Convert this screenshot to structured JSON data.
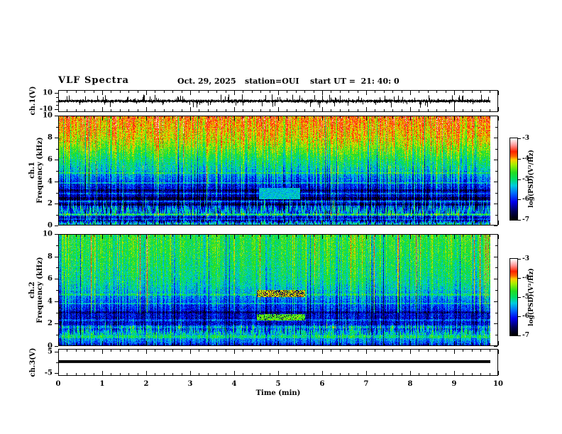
{
  "header": {
    "title": "VLF Spectra",
    "date": "Oct. 29, 2025",
    "station": "station=OUI",
    "start_ut": "start UT =  21: 40: 0"
  },
  "chart_data": {
    "type": "heatmap",
    "title": "VLF Spectra",
    "x_axis": {
      "label": "Time (min)",
      "min": 0,
      "max": 10,
      "major_step": 1,
      "minor_step": 0.2,
      "data_end": 9.84
    },
    "colormap": {
      "vmin": -7,
      "vmax": -3,
      "stops": [
        [
          0,
          "#000000"
        ],
        [
          0.1,
          "#000055"
        ],
        [
          0.22,
          "#0000ee"
        ],
        [
          0.32,
          "#0066ff"
        ],
        [
          0.42,
          "#00ccdd"
        ],
        [
          0.5,
          "#00dd66"
        ],
        [
          0.58,
          "#22dd22"
        ],
        [
          0.68,
          "#aaee00"
        ],
        [
          0.74,
          "#ffcc00"
        ],
        [
          0.78,
          "#ff6600"
        ],
        [
          0.84,
          "#ff2200"
        ],
        [
          0.92,
          "#ff9999"
        ],
        [
          1,
          "#ffffff"
        ]
      ]
    },
    "colorbars": [
      {
        "label": "log(PSD)(V²/Hz)",
        "ticks": [
          -3,
          -4,
          -5,
          -6,
          -7
        ]
      },
      {
        "label": "log(PSD)(V²/Hz)",
        "ticks": [
          -3,
          -4,
          -5,
          -6,
          -7
        ]
      }
    ],
    "panels": [
      {
        "id": "ch1_wave",
        "type": "waveform",
        "ylabel": "ch.1(V)",
        "ymin": -13,
        "ymax": 13,
        "yticks": [
          10,
          5,
          0,
          -5,
          -10
        ],
        "ytick_labels": {
          "10": "10",
          "-10": "-10"
        },
        "signal": {
          "noise_amp": 1.4,
          "spike_prob": 0.25,
          "spike_max": 8.5,
          "seed": 11
        }
      },
      {
        "id": "ch1_spec",
        "type": "spectrogram",
        "ylabel_lines": [
          "ch.1",
          "Frequency (kHz)"
        ],
        "fmin": 0,
        "fmax": 10,
        "ytick_major": [
          0,
          2,
          4,
          6,
          8,
          10
        ],
        "ytick_minor": [
          1,
          3,
          5,
          7,
          9
        ],
        "seed": 7,
        "profile": [
          [
            0,
            -5.4
          ],
          [
            0.15,
            -5.1
          ],
          [
            0.4,
            -6.5
          ],
          [
            0.8,
            -6.1
          ],
          [
            1.1,
            -5.15
          ],
          [
            1.5,
            -5.5
          ],
          [
            1.8,
            -6.25
          ],
          [
            2.6,
            -6.4
          ],
          [
            3.6,
            -6.05
          ],
          [
            4.4,
            -5.6
          ],
          [
            5,
            -5.25
          ],
          [
            6,
            -4.9
          ],
          [
            7,
            -4.45
          ],
          [
            8,
            -4.1
          ],
          [
            10,
            -3.8
          ]
        ],
        "h_lines": [
          {
            "f": 0.55,
            "dv": 0.5,
            "w": 0.08
          },
          {
            "f": 0.95,
            "dv": 0.7,
            "w": 0.1
          },
          {
            "f": 1.9,
            "dv": -0.5,
            "w": 0.12
          },
          {
            "f": 2.2,
            "dv": 0.55,
            "w": 0.07
          },
          {
            "f": 2.45,
            "dv": -0.45,
            "w": 0.1
          },
          {
            "f": 2.9,
            "dv": 0.5,
            "w": 0.07
          },
          {
            "f": 3.2,
            "dv": -0.4,
            "w": 0.1
          },
          {
            "f": 3.9,
            "dv": 0.55,
            "w": 0.07
          },
          {
            "f": 4.8,
            "dv": 0.45,
            "w": 0.07
          }
        ],
        "features": [
          {
            "t0": 4.55,
            "t1": 5.5,
            "f0": 2.4,
            "f1": 3.4,
            "v": -5.35,
            "speckle": 0
          }
        ],
        "jag": 0.5,
        "col_jitter": 0.33,
        "cell_noise": 0.3,
        "streak_prob": 0.07,
        "streak_boost": 0.85,
        "streak_band": [
          0.4,
          5.5
        ]
      },
      {
        "id": "ch2_spec",
        "type": "spectrogram",
        "ylabel_lines": [
          "ch.2",
          "Frequency (kHz)"
        ],
        "fmin": 0,
        "fmax": 10,
        "ytick_major": [
          0,
          2,
          4,
          6,
          8,
          10
        ],
        "ytick_minor": [
          1,
          3,
          5,
          7,
          9
        ],
        "seed": 13,
        "profile": [
          [
            0,
            -6.3
          ],
          [
            0.2,
            -5.8
          ],
          [
            0.5,
            -5.55
          ],
          [
            0.9,
            -5.35
          ],
          [
            1.2,
            -4.95
          ],
          [
            1.5,
            -5.9
          ],
          [
            2.1,
            -6.3
          ],
          [
            2.7,
            -6.2
          ],
          [
            3.4,
            -6.0
          ],
          [
            4.2,
            -5.65
          ],
          [
            5,
            -5.3
          ],
          [
            6,
            -5.05
          ],
          [
            7,
            -4.95
          ],
          [
            8.5,
            -4.8
          ],
          [
            10,
            -4.75
          ]
        ],
        "h_lines": [
          {
            "f": 0.8,
            "dv": 0.4,
            "w": 0.1
          },
          {
            "f": 1.7,
            "dv": 0.5,
            "w": 0.1
          },
          {
            "f": 2.3,
            "dv": 0.45,
            "w": 0.08
          },
          {
            "f": 3.0,
            "dv": -0.4,
            "w": 0.1
          },
          {
            "f": 3.8,
            "dv": 0.45,
            "w": 0.08
          },
          {
            "f": 4.6,
            "dv": 0.4,
            "w": 0.08
          }
        ],
        "features": [
          {
            "t0": 4.5,
            "t1": 5.6,
            "f0": 4.4,
            "f1": 5.05,
            "v": -4.15,
            "speckle": 0.35
          },
          {
            "t0": 4.5,
            "t1": 5.6,
            "f0": 2.3,
            "f1": 2.85,
            "v": -4.55,
            "speckle": 0.15
          }
        ],
        "jag": 0.4,
        "col_jitter": 0.3,
        "cell_noise": 0.3,
        "streak_prob": 0.06,
        "streak_boost": 1.1,
        "streak_band": [
          3,
          10
        ]
      },
      {
        "id": "ch3_wave",
        "type": "flatline",
        "ylabel": "ch.3(V)",
        "ymin": -6.5,
        "ymax": 6.5,
        "yticks": [
          5,
          0,
          -5
        ],
        "ytick_labels": {
          "5": "5",
          "-5": "-5"
        },
        "line_value": 0.4,
        "line_thickness": 4,
        "line_color": "#000000"
      }
    ]
  }
}
